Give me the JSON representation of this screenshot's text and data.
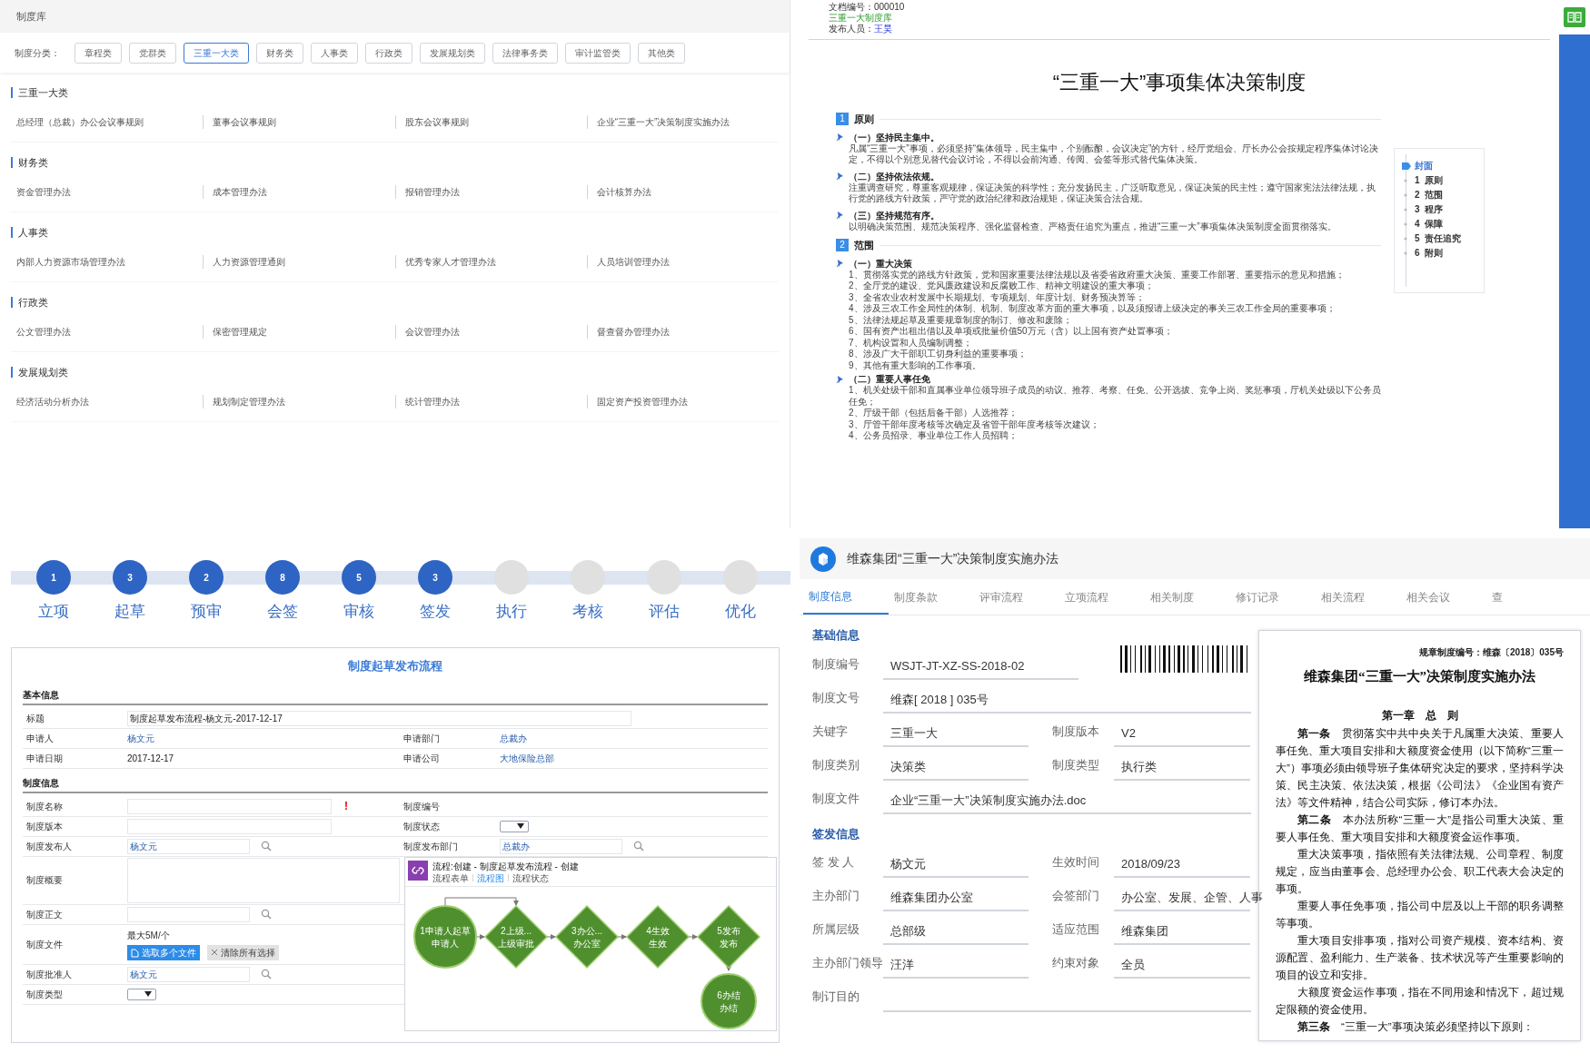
{
  "library": {
    "title": "制度库",
    "filter_label": "制度分类：",
    "filters": [
      {
        "label": "章程类",
        "selected": false
      },
      {
        "label": "党群类",
        "selected": false
      },
      {
        "label": "三重一大类",
        "selected": true
      },
      {
        "label": "财务类",
        "selected": false
      },
      {
        "label": "人事类",
        "selected": false
      },
      {
        "label": "行政类",
        "selected": false
      },
      {
        "label": "发展规划类",
        "selected": false
      },
      {
        "label": "法律事务类",
        "selected": false
      },
      {
        "label": "审计监管类",
        "selected": false
      },
      {
        "label": "其他类",
        "selected": false
      }
    ],
    "sections": [
      {
        "title": "三重一大类",
        "items": [
          "总经理（总裁）办公会议事规则",
          "董事会议事规则",
          "股东会议事规则",
          "企业“三重一大”决策制度实施办法"
        ]
      },
      {
        "title": "财务类",
        "items": [
          "资金管理办法",
          "成本管理办法",
          "报销管理办法",
          "会计核算办法"
        ]
      },
      {
        "title": "人事类",
        "items": [
          "内部人力资源市场管理办法",
          "人力资源管理通则",
          "优秀专家人才管理办法",
          "人员培训管理办法"
        ]
      },
      {
        "title": "行政类",
        "items": [
          "公文管理办法",
          "保密管理规定",
          "会议管理办法",
          "督查督办管理办法"
        ]
      },
      {
        "title": "发展规划类",
        "items": [
          "经济活动分析办法",
          "规划制定管理办法",
          "统计管理办法",
          "固定资产投资管理办法"
        ]
      }
    ]
  },
  "document": {
    "doc_number_label": "文档编号：",
    "doc_number": "000010",
    "library": "三重一大制度库",
    "publisher_label": "发布人员：",
    "publisher": "王昊",
    "title": "“三重一大”事项集体决策制度",
    "sections": [
      {
        "number": "1",
        "title": "原则",
        "subsections": [
          {
            "title": "（一）坚持民主集中。",
            "paragraph": "凡属“三重一大”事项，必须坚持“集体领导，民主集中，个别酝酿，会议决定”的方针，经厅党组会、厅长办公会按规定程序集体讨论决定，不得以个别意见替代会议讨论，不得以会前沟通、传阅、会签等形式替代集体决策。"
          },
          {
            "title": "（二）坚持依法依规。",
            "paragraph": "注重调查研究，尊重客观规律，保证决策的科学性；充分发扬民主，广泛听取意见，保证决策的民主性；遵守国家宪法法律法规，执行党的路线方针政策，严守党的政治纪律和政治规矩，保证决策合法合规。"
          },
          {
            "title": "（三）坚持规范有序。",
            "paragraph": "以明确决策范围、规范决策程序、强化监督检查、严格责任追究为重点，推进“三重一大”事项集体决策制度全面贯彻落实。"
          }
        ]
      },
      {
        "number": "2",
        "title": "范围",
        "subsections": [
          {
            "title": "（一）重大决策",
            "list": [
              "1、贯彻落实党的路线方针政策，党和国家重要法律法规以及省委省政府重大决策、重要工作部署、重要指示的意见和措施；",
              "2、全厅党的建设、党风廉政建设和反腐败工作、精神文明建设的重大事项；",
              "3、全省农业农村发展中长期规划、专项规划、年度计划、财务预决算等；",
              "4、涉及三农工作全局性的体制、机制、制度改革方面的重大事项，以及须报请上级决定的事关三农工作全局的重要事项；",
              "5、法律法规起草及重要规章制度的制订、修改和废除；",
              "6、国有资产出租出借以及单项或批量价值50万元（含）以上国有资产处置事项；",
              "7、机构设置和人员编制调整；",
              "8、涉及广大干部职工切身利益的重要事项；",
              "9、其他有重大影响的工作事项。"
            ]
          },
          {
            "title": "（二）重要人事任免",
            "list": [
              "1、机关处级干部和直属事业单位领导班子成员的动议、推荐、考察、任免、公开选拔、竞争上岗、奖惩事项，厅机关处级以下公务员任免；",
              "2、厅级干部（包括后备干部）人选推荐；",
              "3、厅管干部年度考核等次确定及省管干部年度考核等次建议；",
              "4、公务员招录、事业单位工作人员招聘；"
            ]
          }
        ]
      }
    ],
    "toc": [
      {
        "label": "封面",
        "selected": true
      },
      {
        "number": "1",
        "label": "原则",
        "selected": false
      },
      {
        "number": "2",
        "label": "范围",
        "selected": false
      },
      {
        "number": "3",
        "label": "程序",
        "selected": false
      },
      {
        "number": "4",
        "label": "保障",
        "selected": false
      },
      {
        "number": "5",
        "label": "责任追究",
        "selected": false
      },
      {
        "number": "6",
        "label": "附则",
        "selected": false
      }
    ]
  },
  "steps": [
    {
      "label": "立项",
      "count": "1",
      "active": true
    },
    {
      "label": "起草",
      "count": "3",
      "active": true
    },
    {
      "label": "预审",
      "count": "2",
      "active": true
    },
    {
      "label": "会签",
      "count": "8",
      "active": true
    },
    {
      "label": "审核",
      "count": "5",
      "active": true
    },
    {
      "label": "签发",
      "count": "3",
      "active": true
    },
    {
      "label": "执行",
      "active": false
    },
    {
      "label": "考核",
      "active": false
    },
    {
      "label": "评估",
      "active": false
    },
    {
      "label": "优化",
      "active": false
    }
  ],
  "draft_form": {
    "title": "制度起草发布流程",
    "groups": [
      {
        "title": "基本信息",
        "rows": [
          [
            {
              "label": "标题",
              "kind": "input",
              "value": "制度起草发布流程-杨文元-2017-12-17"
            }
          ],
          [
            {
              "label": "申请人",
              "kind": "link",
              "value": "杨文元"
            },
            {
              "label": "申请部门",
              "kind": "link",
              "value": "总裁办"
            }
          ],
          [
            {
              "label": "申请日期",
              "kind": "text",
              "value": "2017-12-17"
            },
            {
              "label": "申请公司",
              "kind": "link",
              "value": "大地保险总部"
            }
          ]
        ]
      },
      {
        "title": "制度信息",
        "rows": [
          [
            {
              "label": "制度名称",
              "kind": "input",
              "flag": "!"
            },
            {
              "label": "制度编号",
              "kind": "text"
            }
          ],
          [
            {
              "label": "制度版本",
              "kind": "input"
            },
            {
              "label": "制度状态",
              "kind": "select"
            }
          ],
          [
            {
              "label": "制度发布人",
              "kind": "lookup",
              "value": "杨文元"
            },
            {
              "label": "制度发布部门",
              "kind": "lookup",
              "value": "总裁办"
            }
          ],
          [
            {
              "label": "制度概要",
              "kind": "textarea"
            }
          ],
          [
            {
              "label": "制度正文",
              "kind": "lookup"
            }
          ],
          [
            {
              "label": "制度文件",
              "kind": "files",
              "note": "最大5M/个",
              "buttons": [
                "选取多个文件",
                "清除所有选择"
              ]
            }
          ],
          [
            {
              "label": "制度批准人",
              "kind": "lookup",
              "value": "杨文元"
            }
          ],
          [
            {
              "label": "制度类型",
              "kind": "select"
            }
          ]
        ]
      }
    ],
    "flow_window": {
      "title": "流程:创建 - 制度起草发布流程 - 创建",
      "tabs": [
        {
          "label": "流程表单",
          "selected": false
        },
        {
          "label": "流程图",
          "selected": true
        },
        {
          "label": "流程状态",
          "selected": false
        }
      ],
      "nodes": [
        {
          "kind": "start",
          "line1": "1申请人起草",
          "line2": "申请人"
        },
        {
          "kind": "task",
          "line1": "2上级...",
          "line2": "上级审批"
        },
        {
          "kind": "task",
          "line1": "3办公...",
          "line2": "办公室"
        },
        {
          "kind": "task",
          "line1": "4生效",
          "line2": "生效"
        },
        {
          "kind": "task",
          "line1": "5发布",
          "line2": "发布"
        },
        {
          "kind": "end",
          "line1": "6办结",
          "line2": "办结"
        }
      ]
    }
  },
  "policy": {
    "title": "维森集团“三重一大”决策制度实施办法",
    "tabs": [
      {
        "label": "制度信息",
        "selected": true
      },
      {
        "label": "制度条款",
        "selected": false
      },
      {
        "label": "评审流程",
        "selected": false
      },
      {
        "label": "立项流程",
        "selected": false
      },
      {
        "label": "相关制度",
        "selected": false
      },
      {
        "label": "修订记录",
        "selected": false
      },
      {
        "label": "相关流程",
        "selected": false
      },
      {
        "label": "相关会议",
        "selected": false
      },
      {
        "label": "查",
        "selected": false
      }
    ],
    "groups": [
      {
        "title": "基础信息",
        "rows": [
          [
            {
              "label": "制度编号",
              "value": "WSJT-JT-XZ-SS-2018-02"
            }
          ],
          [
            {
              "label": "制度文号",
              "value": "维森[ 2018 ] 035号"
            }
          ],
          [
            {
              "label": "关键字",
              "value": "三重一大"
            },
            {
              "label": "制度版本",
              "value": "V2"
            }
          ],
          [
            {
              "label": "制度类别",
              "value": "决策类"
            },
            {
              "label": "制度类型",
              "value": "执行类"
            }
          ],
          [
            {
              "label": "制度文件",
              "value": "企业“三重一大”决策制度实施办法.doc"
            }
          ]
        ]
      },
      {
        "title": "签发信息",
        "rows": [
          [
            {
              "label": "签 发 人",
              "value": "杨文元"
            },
            {
              "label": "生效时间",
              "value": "2018/09/23"
            }
          ],
          [
            {
              "label": "主办部门",
              "value": "维森集团办公室"
            },
            {
              "label": "会签部门",
              "value": "办公室、发展、企管、人事"
            }
          ],
          [
            {
              "label": "所属层级",
              "value": "总部级"
            },
            {
              "label": "适应范围",
              "value": "维森集团"
            }
          ],
          [
            {
              "label": "主办部门领导",
              "value": "汪洋"
            },
            {
              "label": "约束对象",
              "value": "全员"
            }
          ],
          [
            {
              "label": "制订目的"
            }
          ]
        ]
      }
    ],
    "preview": {
      "number_line": "规章制度编号：维森〔2018〕035号",
      "title": "维森集团“三重一大”决策制度实施办法",
      "chapter": "第一章　总　则",
      "paragraphs": [
        "**第一条**　贯彻落实中共中央关于凡属重大决策、重要人事任免、重大项目安排和大额度资金使用（以下简称“三重一大”）事项必须由领导班子集体研究决定的要求，坚持科学决策、民主决策、依法决策，根据《公司法》《企业国有资产法》等文件精神，结合公司实际，修订本办法。",
        "**第二条**　本办法所称“三重一大”是指公司重大决策、重要人事任免、重大项目安排和大额度资金运作事项。",
        "重大决策事项，指依照有关法律法规、公司章程、制度规定，应当由董事会、总经理办公会、职工代表大会决定的事项。",
        "重要人事任免事项，指公司中层及以上干部的职务调整等事项。",
        "重大项目安排事项，指对公司资产规模、资本结构、资源配置、盈利能力、生产装备、技术状况等产生重要影响的项目的设立和安排。",
        "大额度资金运作事项，指在不同用途和情况下，超过规定限额的资金使用。",
        "**第三条**　“三重一大”事项决策必须坚持以下原则："
      ]
    }
  }
}
